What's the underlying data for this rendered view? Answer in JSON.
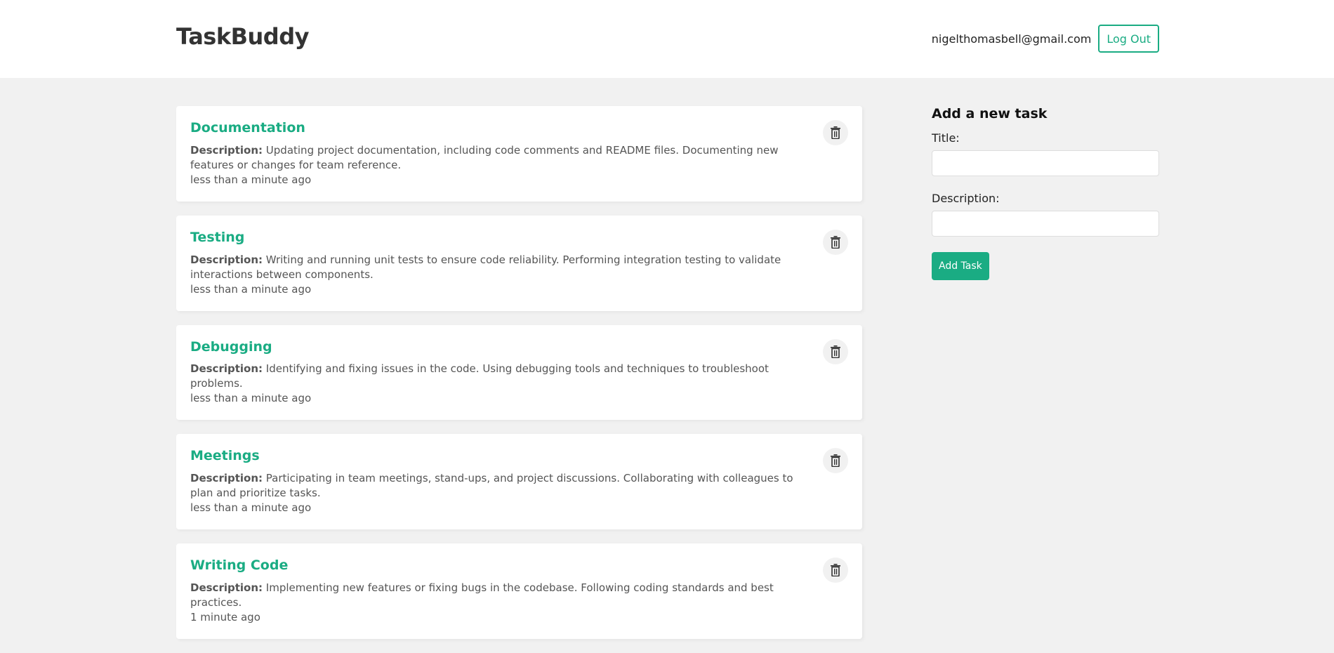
{
  "app": {
    "brand": "TaskBuddy",
    "user_email": "nigelthomasbell@gmail.com",
    "logout_label": "Log Out",
    "accent_color": "#1aac83"
  },
  "tasks": [
    {
      "title": "Documentation",
      "desc_label": "Description:",
      "description": "Updating project documentation, including code comments and README files. Documenting new features or changes for team reference.",
      "time": "less than a minute ago",
      "delete_icon": "trash-icon"
    },
    {
      "title": "Testing",
      "desc_label": "Description:",
      "description": "Writing and running unit tests to ensure code reliability. Performing integration testing to validate interactions between components.",
      "time": "less than a minute ago",
      "delete_icon": "trash-icon"
    },
    {
      "title": "Debugging",
      "desc_label": "Description:",
      "description": "Identifying and fixing issues in the code. Using debugging tools and techniques to troubleshoot problems.",
      "time": "less than a minute ago",
      "delete_icon": "trash-icon"
    },
    {
      "title": "Meetings",
      "desc_label": "Description:",
      "description": "Participating in team meetings, stand-ups, and project discussions. Collaborating with colleagues to plan and prioritize tasks.",
      "time": "less than a minute ago",
      "delete_icon": "trash-icon"
    },
    {
      "title": "Writing Code",
      "desc_label": "Description:",
      "description": "Implementing new features or fixing bugs in the codebase. Following coding standards and best practices.",
      "time": "1 minute ago",
      "delete_icon": "trash-icon"
    }
  ],
  "form": {
    "heading": "Add a new task",
    "title_label": "Title:",
    "title_value": "",
    "description_label": "Description:",
    "description_value": "",
    "submit_label": "Add Task"
  }
}
